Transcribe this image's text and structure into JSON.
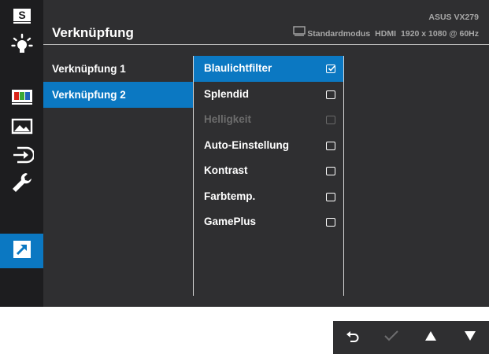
{
  "header": {
    "title": "Verknüpfung",
    "model": "ASUS VX279",
    "mode": "Standardmodus",
    "input": "HDMI",
    "resolution": "1920 x 1080 @ 60Hz"
  },
  "sidebar": {
    "items": [
      {
        "name": "splendid",
        "icon": "splendid-s-icon",
        "label": "S"
      },
      {
        "name": "blue-light",
        "icon": "blue-light-icon"
      },
      {
        "name": "color",
        "icon": "color-icon"
      },
      {
        "name": "image",
        "icon": "image-icon"
      },
      {
        "name": "input-select",
        "icon": "input-select-icon"
      },
      {
        "name": "system-setup",
        "icon": "wrench-icon"
      },
      {
        "name": "shortcut",
        "icon": "shortcut-arrow-icon",
        "active": true
      }
    ]
  },
  "menu1": {
    "items": [
      {
        "label": "Verknüpfung 1",
        "selected": false
      },
      {
        "label": "Verknüpfung 2",
        "selected": true
      }
    ]
  },
  "menu2": {
    "items": [
      {
        "label": "Blaulichtfilter",
        "checked": true,
        "selected": true,
        "disabled": false
      },
      {
        "label": "Splendid",
        "checked": false,
        "selected": false,
        "disabled": false
      },
      {
        "label": "Helligkeit",
        "checked": false,
        "selected": false,
        "disabled": true
      },
      {
        "label": "Auto-Einstellung",
        "checked": false,
        "selected": false,
        "disabled": false
      },
      {
        "label": "Kontrast",
        "checked": false,
        "selected": false,
        "disabled": false
      },
      {
        "label": "Farbtemp.",
        "checked": false,
        "selected": false,
        "disabled": false
      },
      {
        "label": "GamePlus",
        "checked": false,
        "selected": false,
        "disabled": false
      }
    ]
  },
  "keys": [
    {
      "name": "back",
      "icon": "back-arrow-icon"
    },
    {
      "name": "confirm",
      "icon": "check-icon"
    },
    {
      "name": "up",
      "icon": "triangle-up-icon"
    },
    {
      "name": "down",
      "icon": "triangle-down-icon"
    }
  ],
  "colors": {
    "accent": "#0b78c2",
    "panel": "#2f2f31",
    "sidebar": "#1d1d1f"
  }
}
